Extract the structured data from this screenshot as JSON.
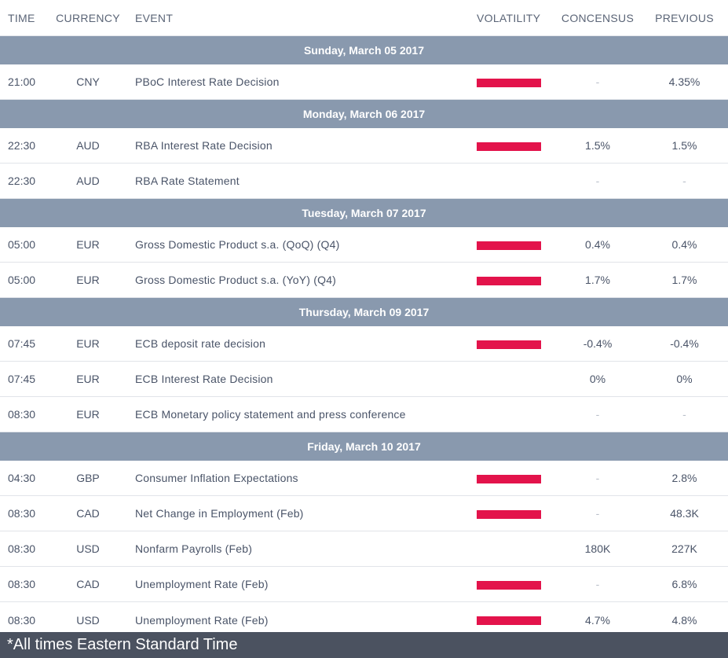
{
  "header": {
    "time": "TIME",
    "currency": "CURRENCY",
    "event": "EVENT",
    "volatility": "VOLATILITY",
    "consensus": "CONCENSUS",
    "previous": "PREVIOUS"
  },
  "days": [
    {
      "label": "Sunday, March 05 2017",
      "rows": [
        {
          "time": "21:00",
          "currency": "CNY",
          "event": "PBoC Interest Rate Decision",
          "volatility": "high",
          "consensus": "-",
          "previous": "4.35%"
        }
      ]
    },
    {
      "label": "Monday, March 06 2017",
      "rows": [
        {
          "time": "22:30",
          "currency": "AUD",
          "event": "RBA Interest Rate Decision",
          "volatility": "high",
          "consensus": "1.5%",
          "previous": "1.5%"
        },
        {
          "time": "22:30",
          "currency": "AUD",
          "event": "RBA Rate Statement",
          "volatility": "",
          "consensus": "-",
          "previous": "-"
        }
      ]
    },
    {
      "label": "Tuesday, March 07 2017",
      "rows": [
        {
          "time": "05:00",
          "currency": "EUR",
          "event": "Gross Domestic Product s.a. (QoQ) (Q4)",
          "volatility": "high",
          "consensus": "0.4%",
          "previous": "0.4%"
        },
        {
          "time": "05:00",
          "currency": "EUR",
          "event": "Gross Domestic Product s.a. (YoY) (Q4)",
          "volatility": "high",
          "consensus": "1.7%",
          "previous": "1.7%"
        }
      ]
    },
    {
      "label": "Thursday, March 09 2017",
      "rows": [
        {
          "time": "07:45",
          "currency": "EUR",
          "event": "ECB deposit rate decision",
          "volatility": "high",
          "consensus": "-0.4%",
          "previous": "-0.4%"
        },
        {
          "time": "07:45",
          "currency": "EUR",
          "event": "ECB Interest Rate Decision",
          "volatility": "",
          "consensus": "0%",
          "previous": "0%"
        },
        {
          "time": "08:30",
          "currency": "EUR",
          "event": "ECB Monetary policy statement and press conference",
          "volatility": "",
          "consensus": "-",
          "previous": "-"
        }
      ]
    },
    {
      "label": "Friday, March 10 2017",
      "rows": [
        {
          "time": "04:30",
          "currency": "GBP",
          "event": "Consumer Inflation Expectations",
          "volatility": "high",
          "consensus": "-",
          "previous": "2.8%"
        },
        {
          "time": "08:30",
          "currency": "CAD",
          "event": "Net Change in Employment (Feb)",
          "volatility": "high",
          "consensus": "-",
          "previous": "48.3K"
        },
        {
          "time": "08:30",
          "currency": "USD",
          "event": "Nonfarm Payrolls (Feb)",
          "volatility": "",
          "consensus": "180K",
          "previous": "227K"
        },
        {
          "time": "08:30",
          "currency": "CAD",
          "event": "Unemployment Rate (Feb)",
          "volatility": "high",
          "consensus": "-",
          "previous": "6.8%"
        },
        {
          "time": "08:30",
          "currency": "USD",
          "event": "Unemployment Rate (Feb)",
          "volatility": "high",
          "consensus": "4.7%",
          "previous": "4.8%"
        }
      ]
    }
  ],
  "footer": {
    "note": "*All times Eastern Standard Time"
  },
  "colors": {
    "day_header_bg": "#8999ae",
    "volatility_bar": "#e3134b",
    "footer_bg": "#4b5260"
  }
}
